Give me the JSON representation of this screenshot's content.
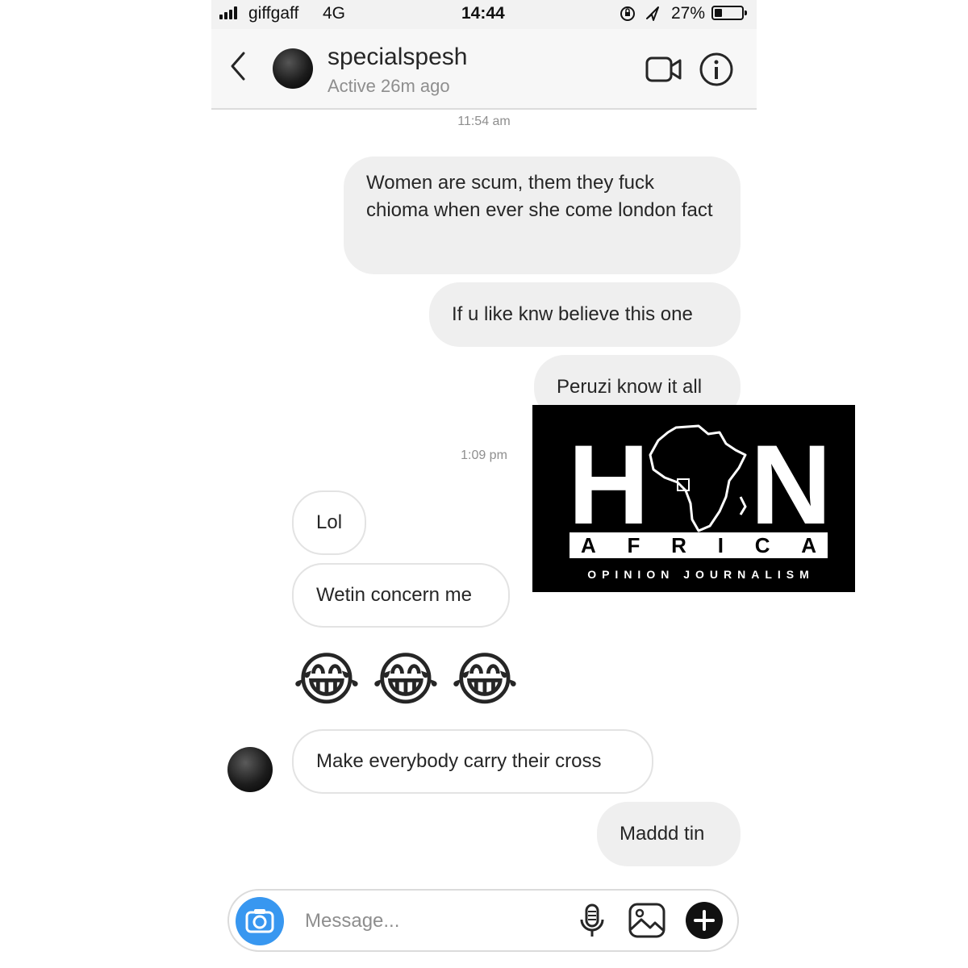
{
  "status_bar": {
    "carrier": "giffgaff",
    "network": "4G",
    "time": "14:44",
    "battery_percent": "27%",
    "battery_level": 0.27
  },
  "header": {
    "username": "specialspesh",
    "status": "Active 26m ago"
  },
  "messages": {
    "timestamp_1": "11:54 am",
    "out_1": "Women are scum, them they fuck chioma  when ever she come london fact",
    "out_2": "If u like knw believe this one",
    "out_3": "Peruzi know it all",
    "timestamp_2": "1:09 pm",
    "in_1": "Lol",
    "in_2": "Wetin concern me",
    "in_3_emoji": "😂😂😂",
    "in_4": "Make everybody carry their cross",
    "out_4": "Maddd tin"
  },
  "composer": {
    "placeholder": "Message..."
  },
  "icons": {
    "back": "chevron-left-icon",
    "video": "video-camera-icon",
    "info": "info-icon",
    "camera": "camera-icon",
    "mic": "microphone-icon",
    "gallery": "image-icon",
    "plus": "plus-icon"
  },
  "watermark": {
    "letters_top": [
      "H",
      "N"
    ],
    "bar_letters": [
      "A",
      "F",
      "R",
      "I",
      "C",
      "A"
    ],
    "tagline": "OPINION JOURNALISM"
  },
  "colors": {
    "outgoing_bubble": "#efefef",
    "incoming_border": "#e3e3e3",
    "camera_button": "#3897f0",
    "watermark_bg": "#000000"
  }
}
